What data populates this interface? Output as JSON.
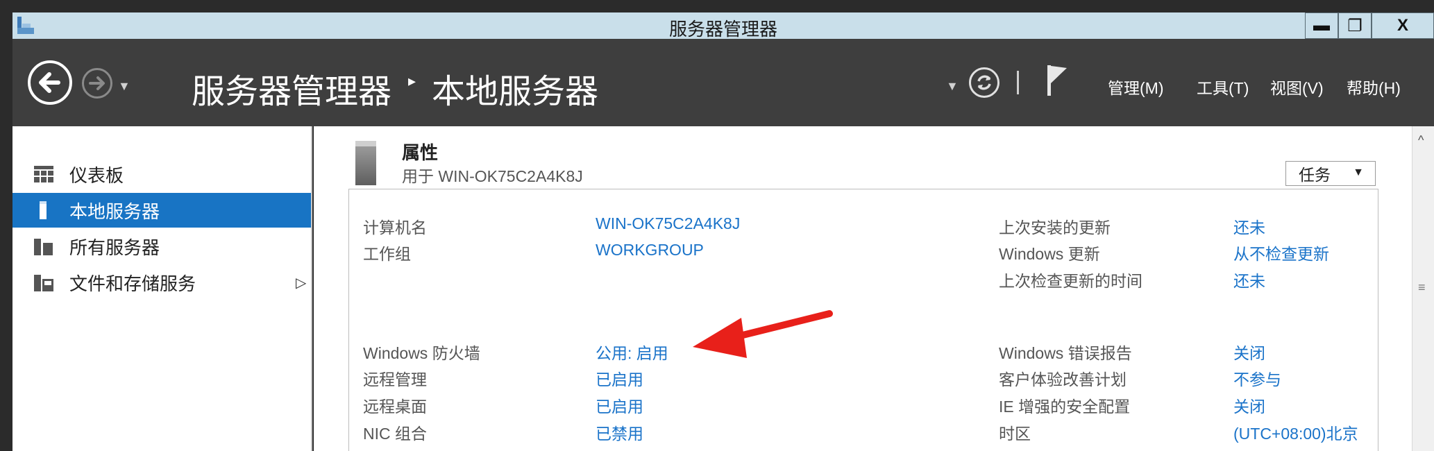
{
  "window": {
    "title": "服务器管理器",
    "min_glyph": "▬",
    "max_glyph": "❐",
    "close_glyph": "X"
  },
  "header": {
    "crumb_root": "服务器管理器",
    "crumb_sep": "▸",
    "crumb_current": "本地服务器",
    "menu": [
      {
        "label": "管理(M)"
      },
      {
        "label": "工具(T)"
      },
      {
        "label": "视图(V)"
      },
      {
        "label": "帮助(H)"
      }
    ]
  },
  "sidebar": {
    "items": [
      {
        "label": "仪表板",
        "icon": "dashboard-icon"
      },
      {
        "label": "本地服务器",
        "icon": "local-server-icon",
        "active": true
      },
      {
        "label": "所有服务器",
        "icon": "all-servers-icon"
      },
      {
        "label": "文件和存储服务",
        "icon": "file-storage-icon",
        "expand_glyph": "▷"
      }
    ]
  },
  "properties": {
    "title": "属性",
    "subtitle": "用于 WIN-OK75C2A4K8J",
    "tasks_label": "任务",
    "left": [
      {
        "label": "计算机名",
        "value": "WIN-OK75C2A4K8J"
      },
      {
        "label": "工作组",
        "value": "WORKGROUP"
      },
      {
        "label": "Windows 防火墙",
        "value": "公用: 启用"
      },
      {
        "label": "远程管理",
        "value": "已启用"
      },
      {
        "label": "远程桌面",
        "value": "已启用"
      },
      {
        "label": "NIC 组合",
        "value": "已禁用"
      }
    ],
    "right": [
      {
        "label": "上次安装的更新",
        "value": "还未"
      },
      {
        "label": "Windows 更新",
        "value": "从不检查更新"
      },
      {
        "label": "上次检查更新的时间",
        "value": "还未"
      },
      {
        "label": "Windows 错误报告",
        "value": "关闭"
      },
      {
        "label": "客户体验改善计划",
        "value": "不参与"
      },
      {
        "label": "IE 增强的安全配置",
        "value": "关闭"
      },
      {
        "label": "时区",
        "value": "(UTC+08:00)北京"
      }
    ]
  },
  "colors": {
    "accent": "#1874c4",
    "link": "#1a73c9",
    "annotation": "#e8201a"
  }
}
